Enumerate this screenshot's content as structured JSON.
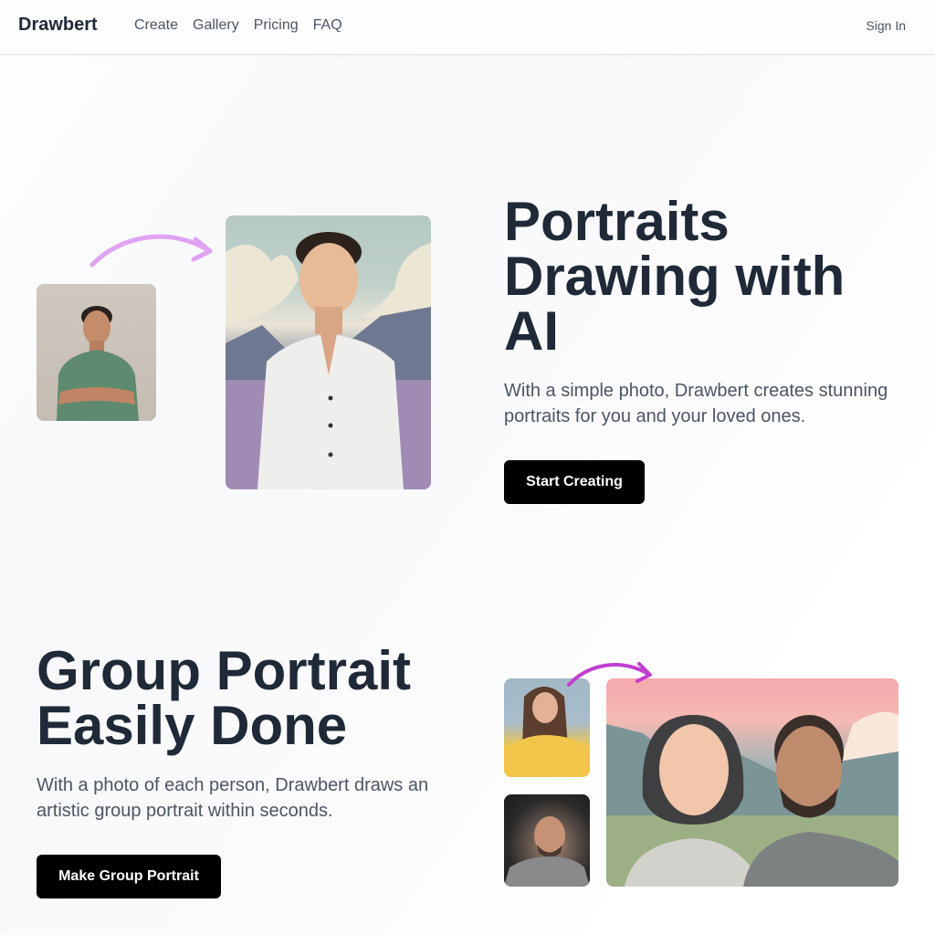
{
  "nav": {
    "brand": "Drawbert",
    "links": [
      "Create",
      "Gallery",
      "Pricing",
      "FAQ"
    ],
    "sign_in": "Sign In"
  },
  "hero": {
    "title_lines": [
      "Portraits",
      "Drawing with",
      "AI"
    ],
    "subtitle": "With a simple photo, Drawbert creates stunning portraits for you and your loved ones.",
    "cta": "Start Creating",
    "images": {
      "source_photo": "man-photo-green-tshirt",
      "result_portrait": "man-illustrated-portrait-white-shirt"
    },
    "arrow_color": "#e0a3f3"
  },
  "group": {
    "title_lines": [
      "Group Portrait",
      "Easily Done"
    ],
    "subtitle": "With a photo of each person, Drawbert draws an artistic group portrait within seconds.",
    "cta": "Make Group Portrait",
    "images": {
      "source_photo_1": "woman-photo-yellow-tshirt",
      "source_photo_2": "man-photo-gray-tshirt",
      "result_portrait": "couple-illustrated-portrait"
    },
    "arrow_color": "#c03fd0"
  },
  "colors": {
    "heading": "#1f2937",
    "body_text": "#4b5563",
    "button_bg": "#000000",
    "button_text": "#ffffff"
  }
}
